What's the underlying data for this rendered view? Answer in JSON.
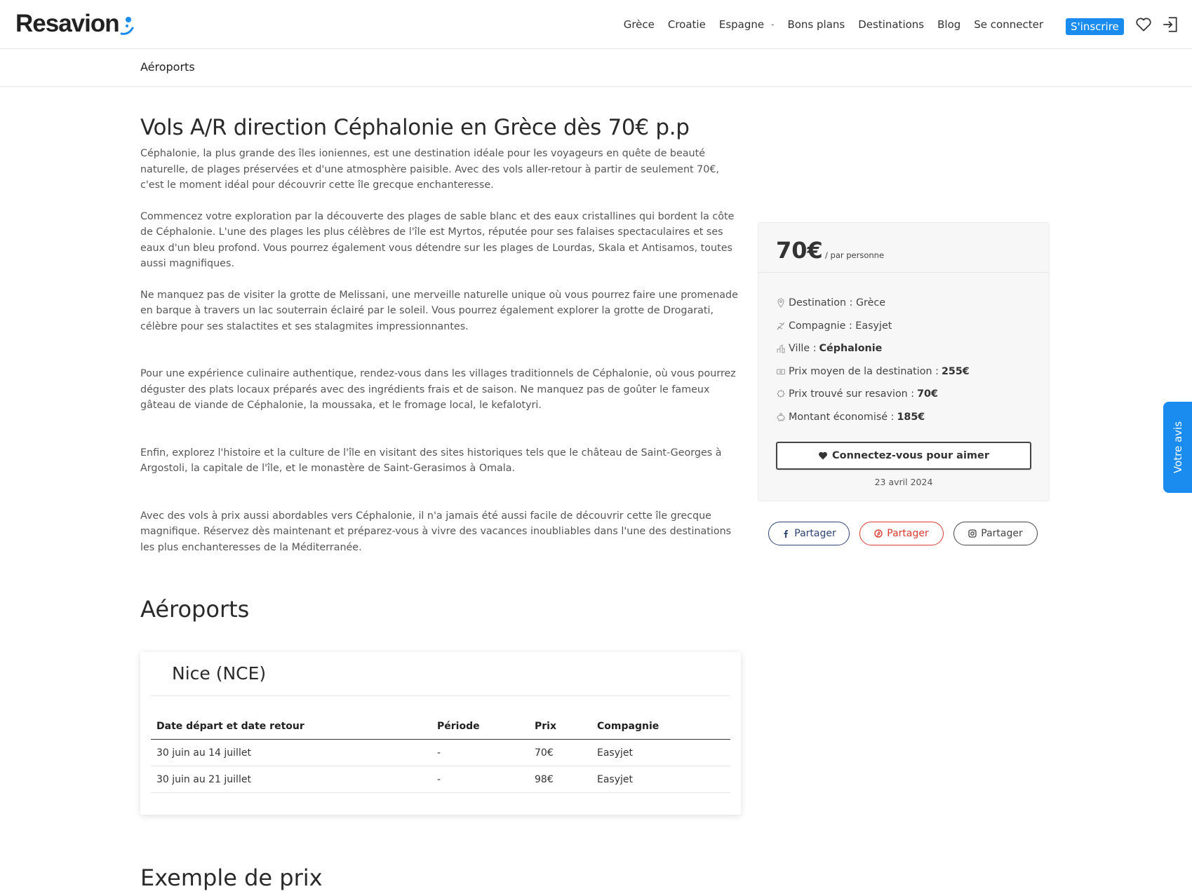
{
  "header": {
    "logo": "Resavion",
    "nav": [
      "Grèce",
      "Croatie",
      "Espagne",
      "Bons plans",
      "Destinations",
      "Blog",
      "Se connecter"
    ],
    "nav_caret": "-",
    "signup_label": "S'inscrire"
  },
  "subbar": {
    "title": "Aéroports"
  },
  "article": {
    "title": "Vols A/R direction Céphalonie en Grèce dès 70€ p.p",
    "paragraphs": [
      "Céphalonie, la plus grande des îles ioniennes, est une destination idéale pour les voyageurs en quête de beauté naturelle, de plages préservées et d'une atmosphère paisible. Avec des vols aller-retour à partir de seulement 70€, c'est le moment idéal pour découvrir cette île grecque enchanteresse.",
      "Commencez votre exploration par la découverte des plages de sable blanc et des eaux cristallines qui bordent la côte de Céphalonie. L'une des plages les plus célèbres de l'île est Myrtos, réputée pour ses falaises spectaculaires et ses eaux d'un bleu profond. Vous pourrez également vous détendre sur les plages de Lourdas, Skala et Antisamos, toutes aussi magnifiques.",
      "Ne manquez pas de visiter la grotte de Melissani, une merveille naturelle unique où vous pourrez faire une promenade en barque à travers un lac souterrain éclairé par le soleil. Vous pourrez également explorer la grotte de Drogarati, célèbre pour ses stalactites et ses stalagmites impressionnantes.",
      "Pour une expérience culinaire authentique, rendez-vous dans les villages traditionnels de Céphalonie, où vous pourrez déguster des plats locaux préparés avec des ingrédients frais et de saison. Ne manquez pas de goûter le fameux gâteau de viande de Céphalonie, la moussaka, et le fromage local, le kefalotyri.",
      "Enfin, explorez l'histoire et la culture de l'île en visitant des sites historiques tels que le château de Saint-Georges à Argostoli, la capitale de l'île, et le monastère de Saint-Gerasimos à Omala.",
      "Avec des vols à prix aussi abordables vers Céphalonie, il n'a jamais été aussi facile de découvrir cette île grecque magnifique. Réservez dès maintenant et préparez-vous à vivre des vacances inoubliables dans l'une des destinations les plus enchanteresses de la Méditerranée."
    ]
  },
  "airports": {
    "heading": "Aéroports",
    "card": {
      "name": "Nice (NCE)",
      "columns": [
        "Date départ et date retour",
        "Période",
        "Prix",
        "Compagnie"
      ],
      "rows": [
        [
          "30 juin au 14 juillet",
          "-",
          "70€",
          "Easyjet"
        ],
        [
          "30 juin au 21 juillet",
          "-",
          "98€",
          "Easyjet"
        ]
      ]
    }
  },
  "examples": {
    "heading": "Exemple de prix"
  },
  "price_box": {
    "price": "70€",
    "unit": "/ par personne",
    "info": [
      {
        "icon": "map-pin-icon",
        "label": "Destination : Grèce",
        "value": ""
      },
      {
        "icon": "plane-icon",
        "label": "Compagnie : Easyjet",
        "value": ""
      },
      {
        "icon": "city-icon",
        "label": "Ville :",
        "value": "Céphalonie"
      },
      {
        "icon": "money-icon",
        "label": "Prix moyen de la destination :",
        "value": "255€"
      },
      {
        "icon": "badge-icon",
        "label": "Prix trouvé sur resavion :",
        "value": "70€"
      },
      {
        "icon": "piggy-bank-icon",
        "label": "Montant économisé :",
        "value": "185€"
      }
    ],
    "like_label": "Connectez-vous pour aimer",
    "date": "23 avril 2024"
  },
  "share": {
    "facebook": "Partager",
    "pinterest": "Partager",
    "instagram": "Partager"
  },
  "feedback": {
    "label": "Votre avis"
  },
  "colors": {
    "accent": "#1a8cf0",
    "facebook": "#2d4373",
    "pinterest": "#d83a2f"
  }
}
